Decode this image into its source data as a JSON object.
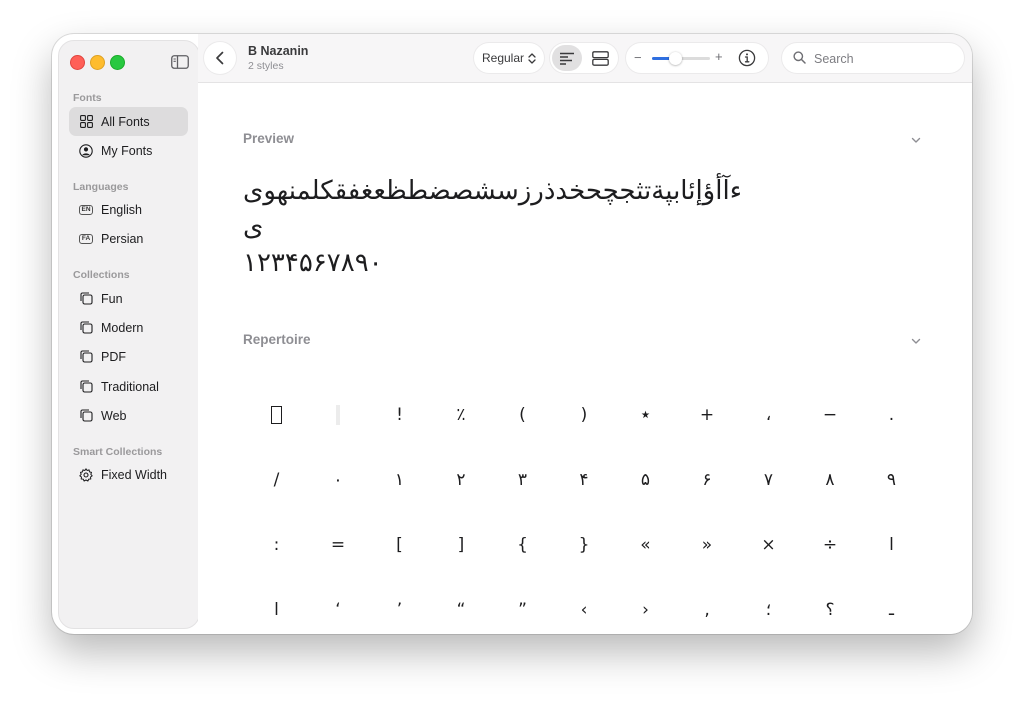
{
  "sidebar": {
    "sections": {
      "fonts": "Fonts",
      "languages": "Languages",
      "collections": "Collections",
      "smart_collections": "Smart Collections"
    },
    "items": [
      {
        "label": "All Fonts",
        "icon": "grid-icon",
        "active": true
      },
      {
        "label": "My Fonts",
        "icon": "person-circle-icon"
      },
      {
        "label": "English",
        "icon": "en-badge-icon",
        "badge": "EN"
      },
      {
        "label": "Persian",
        "icon": "fa-badge-icon",
        "badge": "FA"
      },
      {
        "label": "Fun",
        "icon": "collection-icon"
      },
      {
        "label": "Modern",
        "icon": "collection-icon"
      },
      {
        "label": "PDF",
        "icon": "collection-icon"
      },
      {
        "label": "Traditional",
        "icon": "collection-icon"
      },
      {
        "label": "Web",
        "icon": "collection-icon"
      },
      {
        "label": "Fixed Width",
        "icon": "gear-icon"
      }
    ]
  },
  "toolbar": {
    "font_name": "B Nazanin",
    "font_styles": "2 styles",
    "style_select": "Regular",
    "size_minus": "−",
    "size_plus": "+",
    "size_level": 0.4,
    "search_placeholder": "Search"
  },
  "preview": {
    "title": "Preview",
    "text": "ءآأؤإئابپةتثجچحخدذرزسشصضطظعغفقکلمنهوی",
    "text_wrap": "ی",
    "digits": "۱۲۳۴۵۶۷۸۹۰"
  },
  "repertoire": {
    "title": "Repertoire",
    "glyphs": [
      "",
      "",
      "!",
      "٪",
      "(",
      ")",
      "٭",
      "+",
      "،",
      "−",
      ".",
      "/",
      "٠",
      "١",
      "٢",
      "٣",
      "۴",
      "۵",
      "۶",
      "٧",
      "٨",
      "٩",
      ":",
      "=",
      "[",
      "]",
      "{",
      "}",
      "«",
      "»",
      "×",
      "÷",
      "ا",
      "ا",
      "‘",
      "’",
      "“",
      "”",
      "‹",
      "›",
      "‚",
      "؛",
      "؟",
      "ـ"
    ]
  },
  "colors": {
    "accent": "#2f6fe0",
    "close": "#ff5f57",
    "minimize": "#febc2e",
    "zoom": "#28c840"
  }
}
